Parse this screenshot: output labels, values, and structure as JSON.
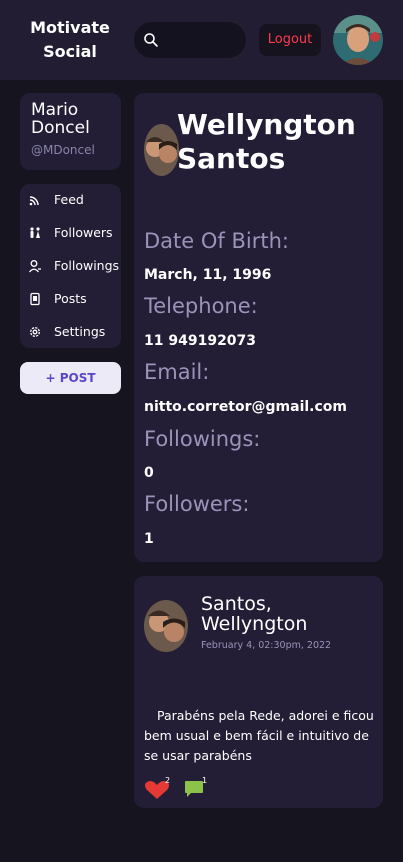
{
  "header": {
    "brand_line1": "Motivate",
    "brand_line2": "Social",
    "search_placeholder": "",
    "logout_label": "Logout"
  },
  "sidebar": {
    "user_name": "Mario Doncel",
    "user_handle": "@MDoncel",
    "items": [
      {
        "label": "Feed",
        "icon": "rss-icon"
      },
      {
        "label": "Followers",
        "icon": "followers-icon"
      },
      {
        "label": "Followings",
        "icon": "user-icon"
      },
      {
        "label": "Posts",
        "icon": "document-icon"
      },
      {
        "label": "Settings",
        "icon": "gear-icon"
      }
    ],
    "post_button_label": "+ POST"
  },
  "profile": {
    "name": "Wellyngton Santos",
    "fields": [
      {
        "label": "Date Of Birth:",
        "value": "March, 11, 1996"
      },
      {
        "label": "Telephone:",
        "value": "11 949192073"
      },
      {
        "label": "Email:",
        "value": "nitto.corretor@gmail.com"
      },
      {
        "label": "Followings:",
        "value": "0"
      },
      {
        "label": "Followers:",
        "value": "1"
      }
    ]
  },
  "post": {
    "author": "Santos, Wellyngton",
    "date": "February 4, 02:30pm, 2022",
    "text": "Parabéns pela Rede, adorei e ficou bem usual e bem fácil e intuitivo de se usar parabéns",
    "likes": "2",
    "comments": "1"
  },
  "colors": {
    "background": "#16141f",
    "card": "#231e36",
    "accent": "#5b45c8",
    "logout": "#ff3b4e",
    "like": "#e53935",
    "comment": "#8bc34a"
  }
}
